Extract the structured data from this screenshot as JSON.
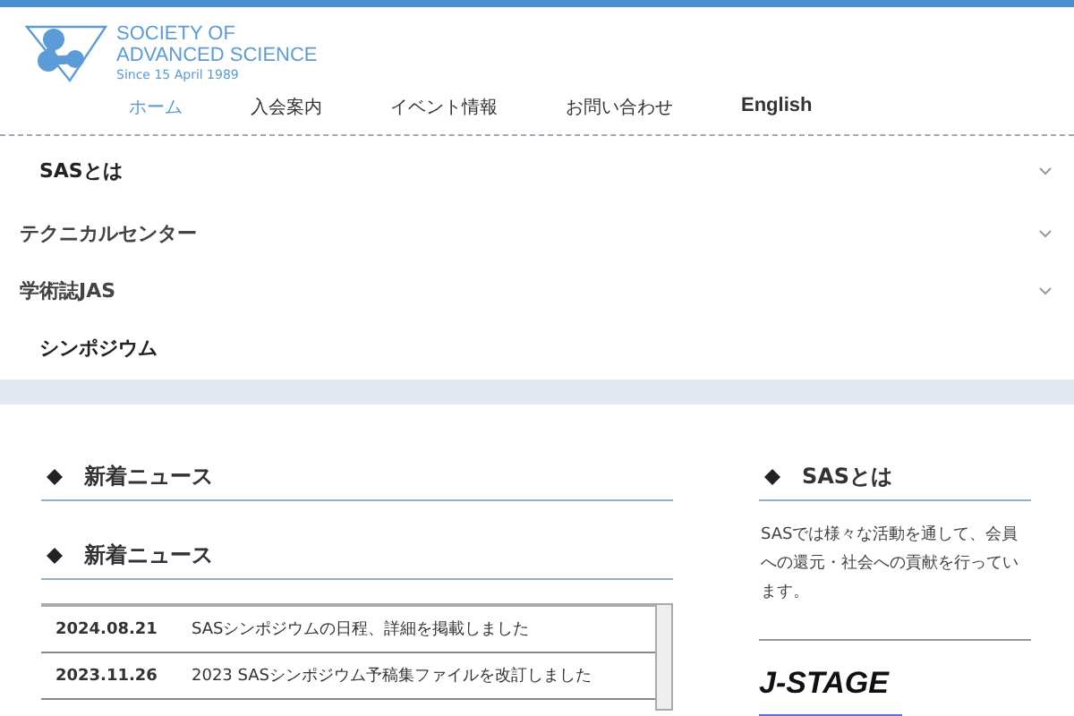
{
  "logo": {
    "line_1": "SOCIETY OF",
    "line_2": "ADVANCED SCIENCE",
    "since": "Since 15 April 1989"
  },
  "nav": [
    {
      "label": "ホーム",
      "selected": true
    },
    {
      "label": "入会案内",
      "selected": false
    },
    {
      "label": "イベント情報",
      "selected": false
    },
    {
      "label": "お問い合わせ",
      "selected": false
    },
    {
      "label": "English",
      "selected": false
    }
  ],
  "menu": [
    {
      "label": "SASとは",
      "indented": true,
      "has_submenu": true
    },
    {
      "label": "テクニカルセンター",
      "indented": false,
      "has_submenu": true
    },
    {
      "label": "学術誌JAS",
      "indented": false,
      "has_submenu": true
    },
    {
      "label": "シンポジウム",
      "indented": true,
      "has_submenu": false
    }
  ],
  "main": {
    "headings": [
      "新着ニュース",
      "新着ニュース"
    ],
    "news": [
      {
        "date": "2024.08.21",
        "title": "SASシンポジウムの日程、詳細を掲載しました"
      },
      {
        "date": "2023.11.26",
        "title": "2023 SASシンポジウム予稿集ファイルを改訂しました"
      }
    ]
  },
  "sidebar": {
    "heading": "SASとは",
    "text": "SASでは様々な活動を通して、会員への還元・社会への貢献を行っています。",
    "banner": "J-STAGE"
  }
}
